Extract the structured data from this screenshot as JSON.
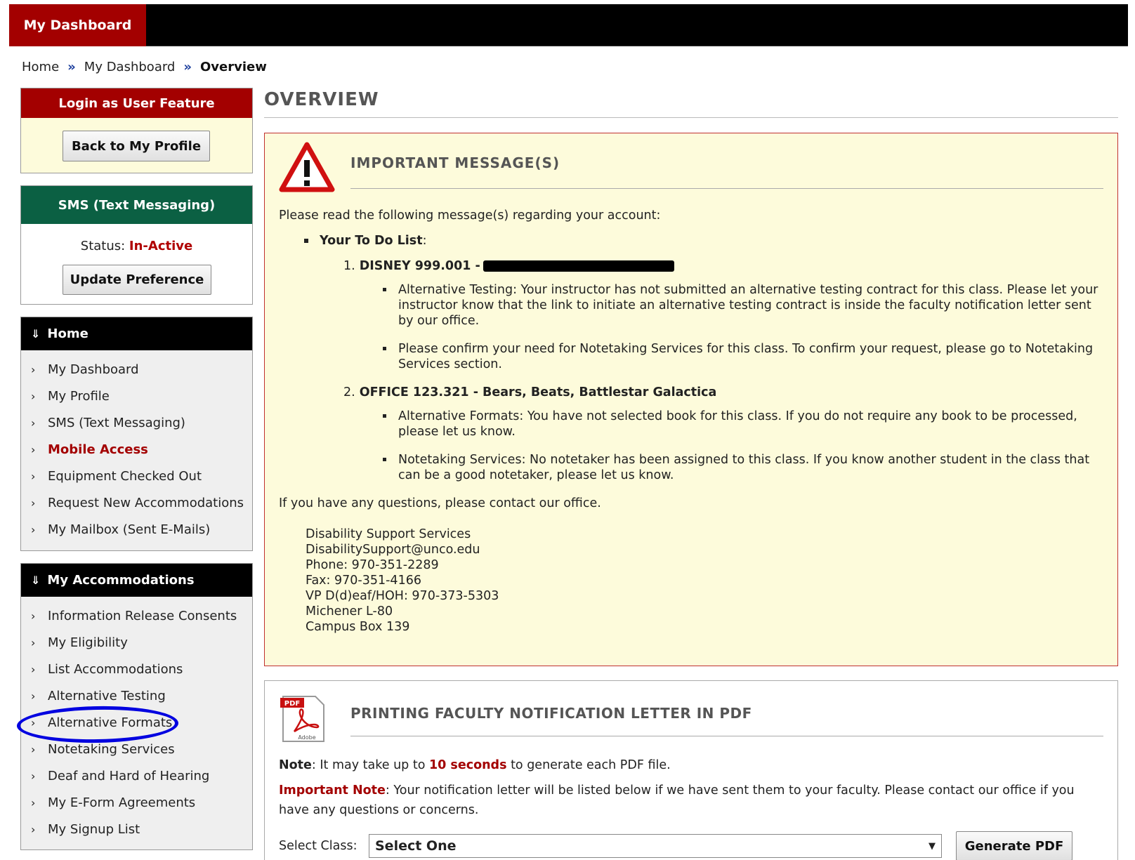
{
  "topbar": {
    "tab_label": "My Dashboard"
  },
  "breadcrumb": {
    "items": [
      "Home",
      "My Dashboard",
      "Overview"
    ],
    "separator": "»"
  },
  "login_box": {
    "title": "Login as User Feature",
    "button": "Back to My Profile"
  },
  "sms_box": {
    "title": "SMS (Text Messaging)",
    "status_label": "Status:",
    "status_value": "In-Active",
    "button": "Update Preference"
  },
  "home_nav": {
    "title": "Home",
    "items": [
      "My Dashboard",
      "My Profile",
      "SMS (Text Messaging)",
      "Mobile Access",
      "Equipment Checked Out",
      "Request New Accommodations",
      "My Mailbox (Sent E-Mails)"
    ]
  },
  "acc_nav": {
    "title": "My Accommodations",
    "items": [
      "Information Release Consents",
      "My Eligibility",
      "List Accommodations",
      "Alternative Testing",
      "Alternative Formats",
      "Notetaking Services",
      "Deaf and Hard of Hearing",
      "My E-Form Agreements",
      "My Signup List"
    ]
  },
  "main": {
    "title": "OVERVIEW"
  },
  "message": {
    "title": "IMPORTANT MESSAGE(S)",
    "intro": "Please read the following message(s) regarding your account:",
    "todo_head": "Your To Do List",
    "todo_colon": ":",
    "courses": [
      {
        "num": "1.",
        "title": "DISNEY 999.001 -",
        "items": [
          "Alternative Testing: Your instructor has not submitted an alternative testing contract for this class. Please let your instructor know that the link to initiate an alternative testing contract is inside the faculty notification letter sent by our office.",
          "Please confirm your need for Notetaking Services for this class. To confirm your request, please go to Notetaking Services section."
        ]
      },
      {
        "num": "2.",
        "title": "OFFICE 123.321 - Bears, Beats, Battlestar Galactica",
        "items": [
          "Alternative Formats: You have not selected book for this class. If you do not require any book to be processed, please let us know.",
          "Notetaking Services: No notetaker has been assigned to this class. If you know another student in the class that can be a good notetaker, please let us know."
        ]
      }
    ],
    "questions": "If you have any questions, please contact our office.",
    "contact": [
      "Disability Support Services",
      "DisabilitySupport@unco.edu",
      "Phone: 970-351-2289",
      "Fax: 970-351-4166",
      "VP D(d)eaf/HOH: 970-373-5303",
      "Michener L-80",
      "Campus Box 139"
    ]
  },
  "pdf": {
    "title": "PRINTING FACULTY NOTIFICATION LETTER IN PDF",
    "icon_label": "PDF",
    "icon_brand": "Adobe",
    "note_label": "Note",
    "note_pre": ": It may take up to ",
    "note_highlight": "10 seconds",
    "note_post": " to generate each PDF file.",
    "important_label": "Important Note",
    "important_text": ": Your notification letter will be listed below if we have sent them to your faculty. Please contact our office if you have any questions or concerns.",
    "select_label": "Select Class:",
    "select_value": "Select One",
    "button": "Generate PDF"
  },
  "colors": {
    "brand_red": "#a30000",
    "sms_green": "#0b6043",
    "message_bg": "#fdfbdb",
    "annotation_circle": "#0000e0"
  },
  "icons": {
    "breadcrumb_sep": "double-chevron-right-icon",
    "nav_arrow": "chevron-right-icon",
    "nav_header": "double-chevron-down-icon",
    "warning": "warning-triangle-icon",
    "pdf": "pdf-file-icon"
  }
}
